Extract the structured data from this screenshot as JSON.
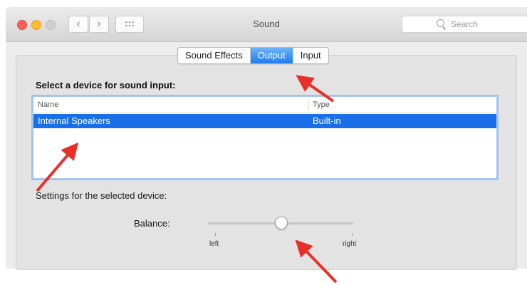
{
  "window": {
    "title": "Sound",
    "search_placeholder": "Search",
    "nav_back": "‹",
    "nav_forward": "›"
  },
  "tabs": [
    {
      "label": "Sound Effects",
      "active": false
    },
    {
      "label": "Output",
      "active": true
    },
    {
      "label": "Input",
      "active": false
    }
  ],
  "section_label": "Select a device for sound input:",
  "table": {
    "headers": {
      "name": "Name",
      "type": "Type"
    },
    "rows": [
      {
        "name": "Internal Speakers",
        "type": "Built-in",
        "selected": true
      }
    ]
  },
  "settings_label": "Settings for the selected device:",
  "balance": {
    "label": "Balance:",
    "left_label": "left",
    "right_label": "right",
    "value": 0.5
  },
  "colors": {
    "accent": "#1a6ee8",
    "annotation_arrow": "#e8302a"
  }
}
